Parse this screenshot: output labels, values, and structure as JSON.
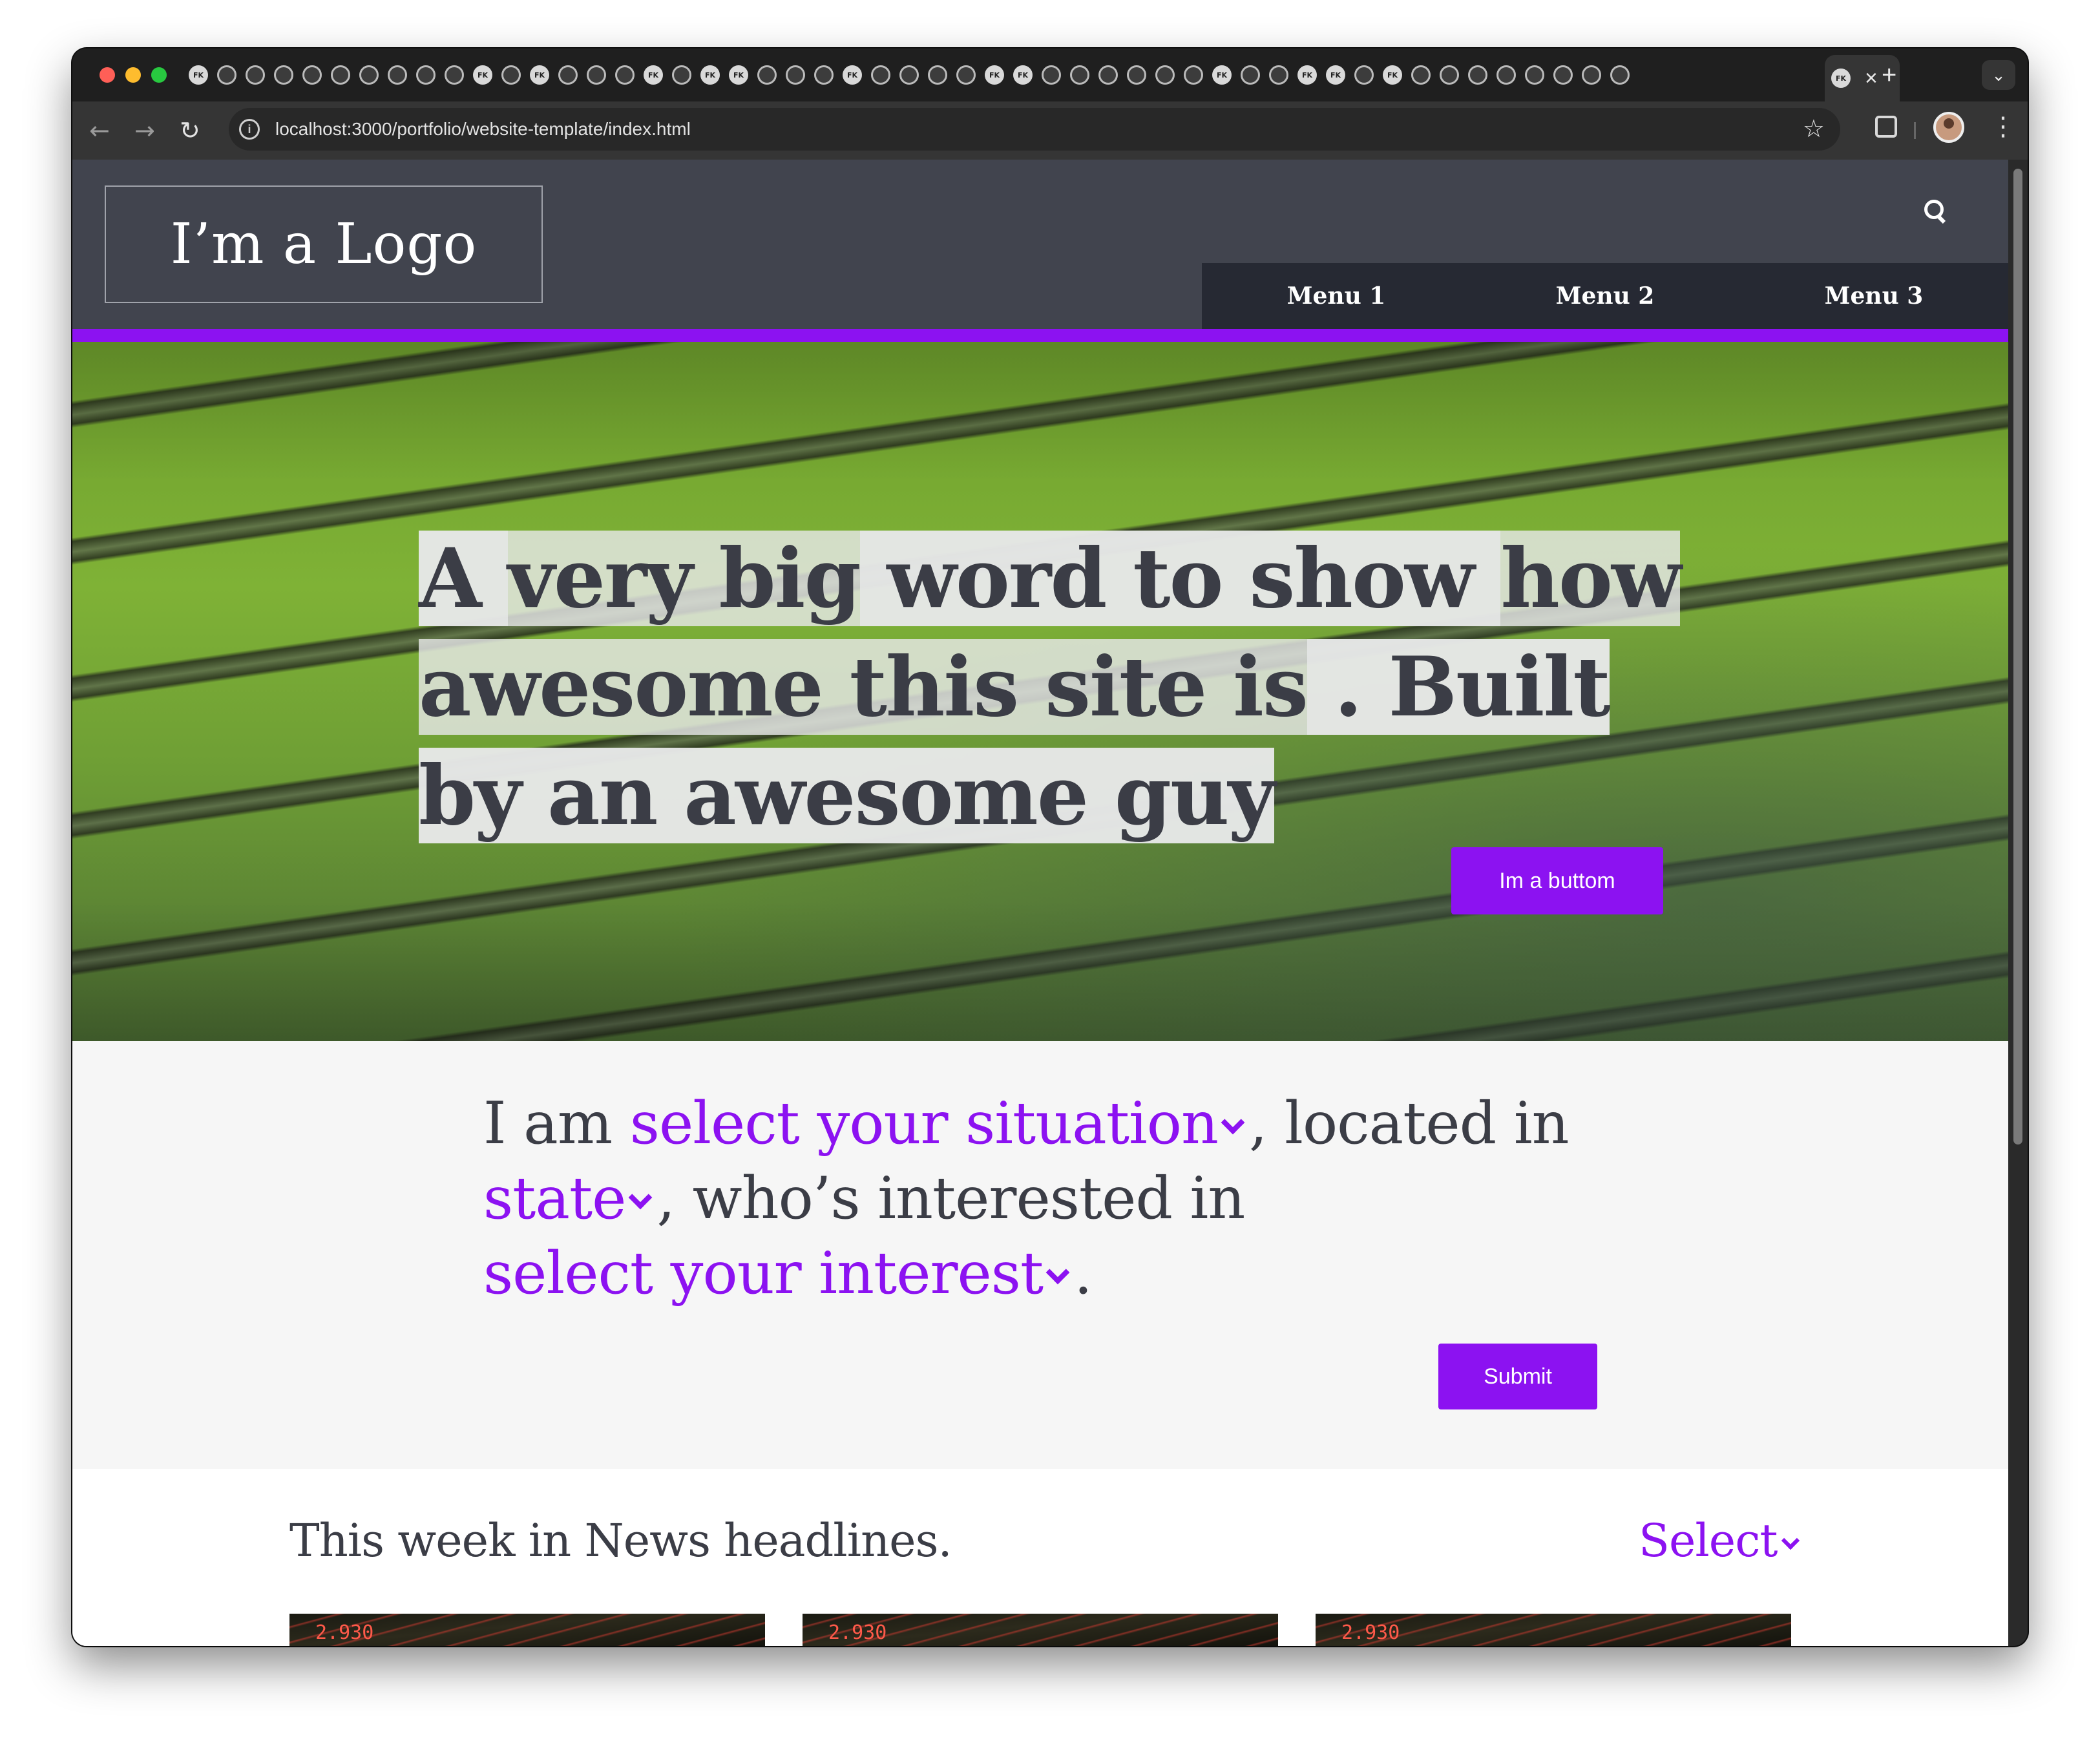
{
  "browser": {
    "tab_favicon_letters": [
      "FK",
      "",
      "",
      "",
      "",
      "",
      "",
      "",
      "",
      "",
      "FK",
      "",
      "FK",
      "",
      "",
      "",
      "FK",
      "",
      "FK",
      "FK",
      "",
      "",
      "",
      "FK",
      "",
      "",
      "",
      "",
      "FK",
      "FK",
      "",
      "",
      "",
      "",
      "",
      "",
      "FK",
      "",
      "",
      "FK",
      "FK",
      "",
      "FK",
      "",
      "",
      "",
      "",
      "",
      "",
      "",
      ""
    ],
    "active_tab_favicon": "FK",
    "active_tab_close": "×",
    "new_tab": "+",
    "tab_search": "⌄",
    "url": "localhost:3000/portfolio/website-template/index.html",
    "info_icon": "i",
    "back": "←",
    "forward": "→",
    "reload": "↻",
    "star": "☆",
    "menu": "⋮"
  },
  "site": {
    "logo": "I’m a Logo",
    "nav": [
      "Menu 1",
      "Menu 2",
      "Menu 3"
    ],
    "hero": {
      "part1": "A ",
      "bold1": "very big",
      "part2": " word to show ",
      "bold2": "how awesome this site is",
      "part3": " . Built by an awesome guy",
      "button": "Im a buttom"
    },
    "selector": {
      "t1": "I am ",
      "situation": "select your situation",
      "t2": ", located in",
      "state": "state",
      "t3": ", who’s interested in",
      "interest": "select your interest",
      "t4": ".",
      "submit": "Submit"
    },
    "news": {
      "title": "This week in News headlines.",
      "select": "Select",
      "card_numbers": [
        "2.930",
        "2.930",
        "2.930"
      ]
    }
  },
  "colors": {
    "accent": "#8c12f1",
    "header_bg": "#41444e",
    "nav_bg": "#262933",
    "text": "#3b3d46"
  }
}
